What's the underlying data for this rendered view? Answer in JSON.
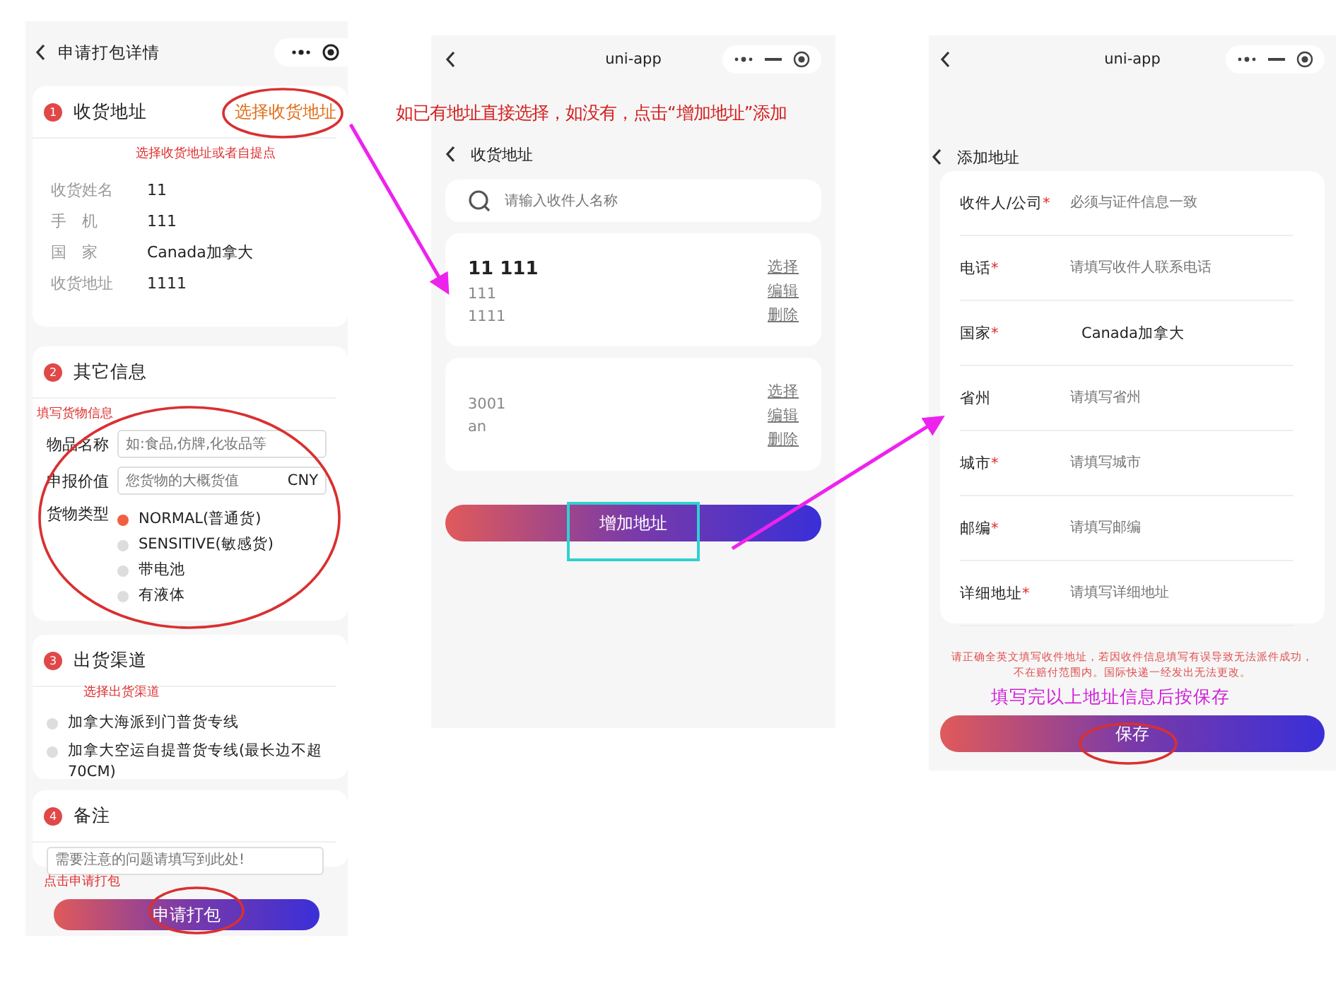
{
  "hint_banner": "如已有地址直接选择，如没有，点击“增加地址”添加",
  "order_page": {
    "title": "申请打包详情",
    "address_section": {
      "number": "1",
      "title": "收货地址",
      "link": "选择收货地址",
      "note": "选择收货地址或者自提点",
      "rows": [
        {
          "label": "收货姓名",
          "value": "11"
        },
        {
          "label": "手　机",
          "value": "111"
        },
        {
          "label": "国　家",
          "value": "Canada加拿大"
        },
        {
          "label": "收货地址",
          "value": "1111"
        }
      ]
    },
    "other_section": {
      "number": "2",
      "title": "其它信息",
      "note": "填写货物信息",
      "name_field": {
        "label": "物品名称",
        "placeholder": "如:食品,仿牌,化妆品等"
      },
      "value_field": {
        "label": "申报价值",
        "placeholder": "您货物的大概货值",
        "unit": "CNY"
      },
      "type_label": "货物类型",
      "types": [
        {
          "label": "NORMAL(普通货)",
          "selected": true
        },
        {
          "label": "SENSITIVE(敏感货)",
          "selected": false
        },
        {
          "label": "带电池",
          "selected": false
        },
        {
          "label": "有液体",
          "selected": false
        }
      ]
    },
    "channel_section": {
      "number": "3",
      "title": "出货渠道",
      "note": "选择出货渠道",
      "channels": [
        {
          "label": "加拿大海派到门普货专线",
          "selected": false
        },
        {
          "label": "加拿大空运自提普货专线(最长边不超70CM)",
          "selected": false
        }
      ]
    },
    "remark_section": {
      "number": "4",
      "title": "备注",
      "placeholder": "需要注意的问题请填写到此处!",
      "note": "点击申请打包"
    },
    "submit": "申请打包"
  },
  "address_page": {
    "app_title": "uni-app",
    "title": "收货地址",
    "search_placeholder": "请输入收件人名称",
    "addresses": [
      {
        "name": "11 111",
        "lines": [
          "111",
          "1111"
        ],
        "actions": [
          "选择",
          "编辑",
          "删除"
        ]
      },
      {
        "lines": [
          "3001",
          "an"
        ],
        "actions": [
          "选择",
          "编辑",
          "删除"
        ]
      }
    ],
    "add_button": "增加地址"
  },
  "add_page": {
    "app_title": "uni-app",
    "title": "添加地址",
    "fields": [
      {
        "label": "收件人/公司",
        "required_mark": "*",
        "placeholder": "必须与证件信息一致"
      },
      {
        "label": "电话",
        "required_mark": "*",
        "placeholder": "请填写收件人联系电话"
      },
      {
        "label": "国家",
        "required_mark": "*",
        "value": "Canada加拿大"
      },
      {
        "label": "省州",
        "placeholder": "请填写省州"
      },
      {
        "label": "城市",
        "required_mark": "*",
        "placeholder": "请填写城市"
      },
      {
        "label": "邮编",
        "required_mark": "*",
        "placeholder": "请填写邮编"
      },
      {
        "label": "详细地址",
        "required_mark": "*",
        "placeholder": "请填写详细地址"
      }
    ],
    "warning": "请正确全英文填写收件地址，若因收件信息填写有误导致无法派件成功，不在赔付范围内。国际快递一经发出无法更改。",
    "save_note": "填写完以上地址信息后按保存",
    "save_button": "保存"
  }
}
